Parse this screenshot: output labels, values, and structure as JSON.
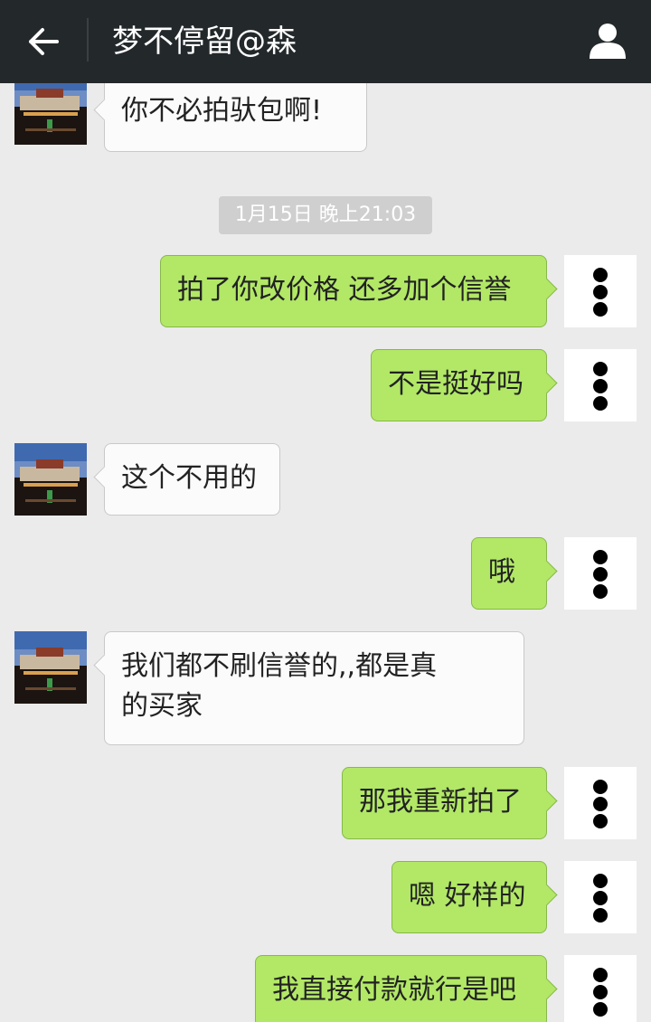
{
  "header": {
    "title": "梦不停留@森",
    "back_icon": "arrow-left-icon",
    "profile_icon": "person-icon"
  },
  "messages": [
    {
      "side": "left",
      "text": "你不必拍驮包啊!"
    },
    {
      "type": "timestamp",
      "text": "1月15日 晚上21:03"
    },
    {
      "side": "right",
      "text": "拍了你改价格 还多加个信誉"
    },
    {
      "side": "right",
      "text": "不是挺好吗"
    },
    {
      "side": "left",
      "text": "这个不用的"
    },
    {
      "side": "right",
      "text": "哦"
    },
    {
      "side": "left",
      "text": "我们都不刷信誉的,,都是真",
      "text2": "的买家"
    },
    {
      "side": "right",
      "text": "那我重新拍了"
    },
    {
      "side": "right",
      "text": "嗯 好样的"
    },
    {
      "side": "right",
      "text": "我直接付款就行是吧"
    }
  ],
  "colors": {
    "topbar": "#23282b",
    "background": "#ebebeb",
    "bubble_right": "#b2e866",
    "bubble_left": "#fbfbfb"
  }
}
